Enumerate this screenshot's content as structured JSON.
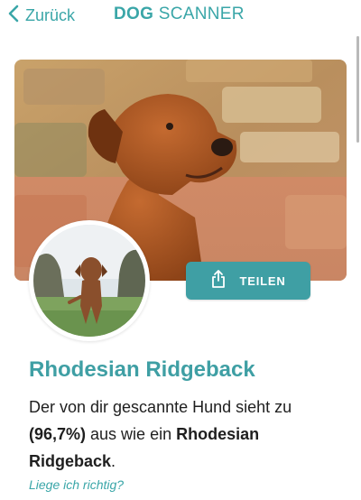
{
  "nav": {
    "back_label": "Zurück",
    "title_bold": "DOG",
    "title_rest": " SCANNER"
  },
  "hero": {
    "share_label": "TEILEN"
  },
  "result": {
    "breed_name": "Rhodesian Ridgeback",
    "text_intro": "Der von dir gescannte Hund sieht zu",
    "percentage": "(96,7%)",
    "text_middle": " aus wie ein ",
    "breed_inline": "Rhodesian Ridgeback",
    "text_end": ".",
    "feedback_link": "Liege ich richtig?"
  },
  "icons": {
    "back": "chevron-left-icon",
    "share": "share-icon"
  },
  "colors": {
    "accent": "#3aa6a8",
    "button": "#3f9fa4",
    "text": "#1f1f1f"
  }
}
